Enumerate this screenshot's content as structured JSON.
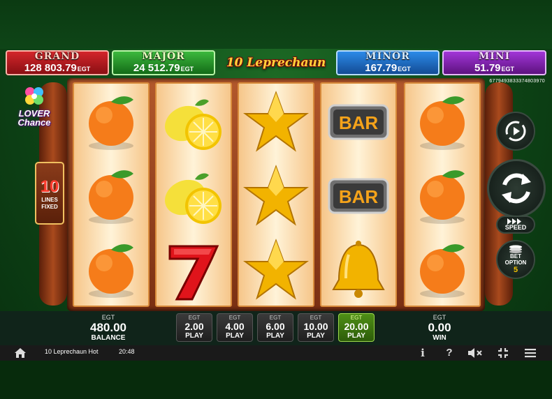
{
  "jackpots": {
    "grand": {
      "title": "GRAND",
      "value": "128 803.79",
      "currency": "EGT"
    },
    "major": {
      "title": "MAJOR",
      "value": "24 512.79",
      "currency": "EGT"
    },
    "minor": {
      "title": "MINOR",
      "value": "167.79",
      "currency": "EGT"
    },
    "mini": {
      "title": "MINI",
      "value": "51.79",
      "currency": "EGT"
    }
  },
  "logo_text": "10 Leprechaun Hot",
  "game_id": "677949383337480397​0",
  "lover_chance": {
    "line1": "LOVER",
    "line2": "Chance"
  },
  "lines_fixed": {
    "number": "10",
    "label_line1": "LINES",
    "label_line2": "FIXED"
  },
  "reels": [
    [
      "orange",
      "orange",
      "orange"
    ],
    [
      "lemon",
      "lemon",
      "seven"
    ],
    [
      "star",
      "star",
      "star"
    ],
    [
      "bar",
      "bar",
      "bell"
    ],
    [
      "orange",
      "orange",
      "orange"
    ]
  ],
  "reel_symbol_text": {
    "bar": "BAR"
  },
  "controls": {
    "autoplay_icon": "autoplay-icon",
    "spin_icon": "spin-icon",
    "speed_label": "SPEED",
    "bet_option": {
      "line1": "BET",
      "line2": "OPTION",
      "value": "5"
    }
  },
  "balance": {
    "currency": "EGT",
    "value": "480.00",
    "label": "BALANCE"
  },
  "win": {
    "currency": "EGT",
    "value": "0.00",
    "label": "WIN"
  },
  "bets": [
    {
      "currency": "EGT",
      "value": "2.00",
      "label": "PLAY",
      "active": false
    },
    {
      "currency": "EGT",
      "value": "4.00",
      "label": "PLAY",
      "active": false
    },
    {
      "currency": "EGT",
      "value": "6.00",
      "label": "PLAY",
      "active": false
    },
    {
      "currency": "EGT",
      "value": "10.00",
      "label": "PLAY",
      "active": false
    },
    {
      "currency": "EGT",
      "value": "20.00",
      "label": "PLAY",
      "active": true
    }
  ],
  "taskbar": {
    "home_icon": "home-icon",
    "game_name": "10 Leprechaun Hot",
    "clock": "20:48",
    "info_label": "i",
    "help_label": "?",
    "mute_icon": "mute-icon",
    "fullscreen_icon": "fullscreen-icon",
    "menu_icon": "menu-icon"
  },
  "colors": {
    "grand": "#d3262b",
    "major": "#3cb83d",
    "minor": "#2c8ae8",
    "mini": "#a236d8",
    "active_bet": "#4e8f16",
    "background": "#0f4a18"
  }
}
